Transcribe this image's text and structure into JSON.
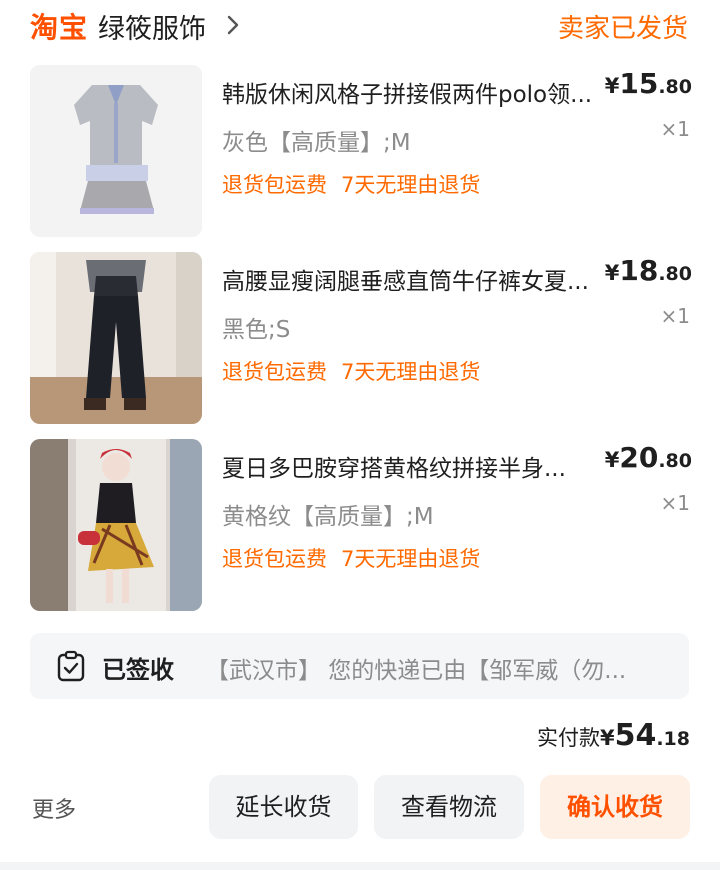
{
  "header": {
    "brand": "淘宝",
    "shop_name": "绿筱服饰",
    "order_status": "卖家已发货"
  },
  "items": [
    {
      "title": "韩版休闲风格子拼接假两件polo领...",
      "price_currency": "¥",
      "price_int": "15",
      "price_dec": ".80",
      "variant": "灰色【高质量】;M",
      "quantity": "×1",
      "tags": [
        "退货包运费",
        "7天无理由退货"
      ]
    },
    {
      "title": "高腰显瘦阔腿垂感直筒牛仔裤女夏...",
      "price_currency": "¥",
      "price_int": "18",
      "price_dec": ".80",
      "variant": "黑色;S",
      "quantity": "×1",
      "tags": [
        "退货包运费",
        "7天无理由退货"
      ]
    },
    {
      "title": "夏日多巴胺穿搭黄格纹拼接半身...",
      "price_currency": "¥",
      "price_int": "20",
      "price_dec": ".80",
      "variant": "黄格纹【高质量】;M",
      "quantity": "×1",
      "tags": [
        "退货包运费",
        "7天无理由退货"
      ]
    }
  ],
  "logistics": {
    "status": "已签收",
    "message": "【武汉市】 您的快递已由【邹军威（勿..."
  },
  "total": {
    "label": "实付款",
    "currency": "¥",
    "int": "54",
    "dec": ".18"
  },
  "actions": {
    "more": "更多",
    "extend": "延长收货",
    "view_logistics": "查看物流",
    "confirm": "确认收货"
  },
  "colors": {
    "brand_orange": "#ff5000",
    "accent_orange": "#ff6a00",
    "muted_gray": "#8c8c8c"
  }
}
